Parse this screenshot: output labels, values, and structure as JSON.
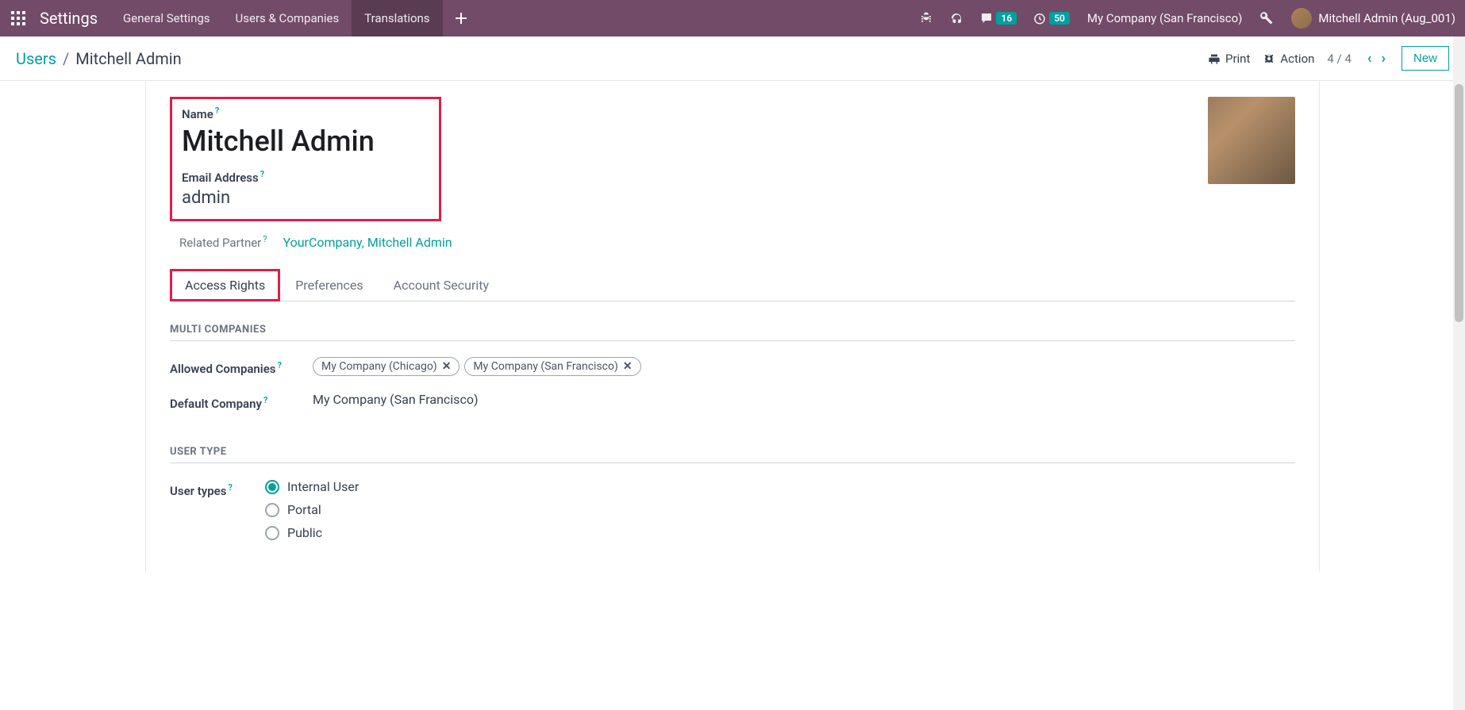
{
  "nav": {
    "title": "Settings",
    "menu": [
      "General Settings",
      "Users & Companies",
      "Translations"
    ],
    "active_menu_index": 2,
    "messages_badge": "16",
    "timer_badge": "50",
    "company": "My Company (San Francisco)",
    "user": "Mitchell Admin (Aug_001)"
  },
  "breadcrumb": {
    "root": "Users",
    "current": "Mitchell Admin"
  },
  "toolbar": {
    "print": "Print",
    "action": "Action",
    "pager": "4 / 4",
    "new": "New"
  },
  "form": {
    "name_label": "Name",
    "name_value": "Mitchell Admin",
    "email_label": "Email Address",
    "email_value": "admin",
    "partner_label": "Related Partner",
    "partner_value": "YourCompany, Mitchell Admin"
  },
  "tabs": [
    "Access Rights",
    "Preferences",
    "Account Security"
  ],
  "sections": {
    "multi_companies_title": "MULTI COMPANIES",
    "allowed_label": "Allowed Companies",
    "allowed_tags": [
      "My Company (Chicago)",
      "My Company (San Francisco)"
    ],
    "default_label": "Default Company",
    "default_value": "My Company (San Francisco)",
    "user_type_title": "USER TYPE",
    "user_types_label": "User types",
    "user_types_options": [
      "Internal User",
      "Portal",
      "Public"
    ],
    "user_types_selected": 0
  }
}
